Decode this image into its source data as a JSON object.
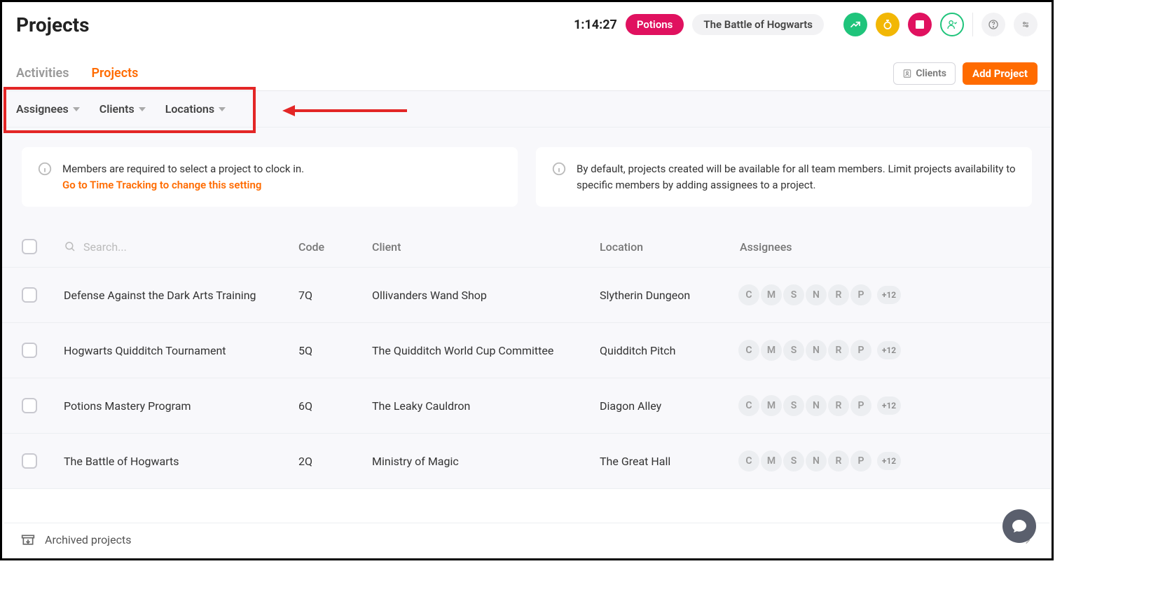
{
  "header": {
    "page_title": "Projects",
    "timer": "1:14:27",
    "pill_pink": "Potions",
    "pill_gray": "The Battle of Hogwarts"
  },
  "tabs": {
    "activities": "Activities",
    "projects": "Projects",
    "clients_btn": "Clients",
    "add_project_btn": "Add Project"
  },
  "filters": {
    "assignees": "Assignees",
    "clients": "Clients",
    "locations": "Locations"
  },
  "info": {
    "card1_line1": "Members are required to select a project to clock in.",
    "card1_link": "Go to Time Tracking to change this setting",
    "card2": "By default, projects created will be available for all team members. Limit projects availability to specific members by adding assignees to a project."
  },
  "table": {
    "search_placeholder": "Search...",
    "col_code": "Code",
    "col_client": "Client",
    "col_location": "Location",
    "col_assignees": "Assignees",
    "avatars": [
      "C",
      "M",
      "S",
      "N",
      "R",
      "P"
    ],
    "more": "+12",
    "rows": [
      {
        "name": "Defense Against the Dark Arts Training",
        "code": "7Q",
        "client": "Ollivanders Wand Shop",
        "location": "Slytherin Dungeon"
      },
      {
        "name": "Hogwarts Quidditch Tournament",
        "code": "5Q",
        "client": "The Quidditch World Cup Committee",
        "location": "Quidditch Pitch"
      },
      {
        "name": "Potions Mastery Program",
        "code": "6Q",
        "client": "The Leaky Cauldron",
        "location": "Diagon Alley"
      },
      {
        "name": "The Battle of Hogwarts",
        "code": "2Q",
        "client": "Ministry of Magic",
        "location": "The Great Hall"
      }
    ]
  },
  "footer": {
    "archived": "Archived projects"
  }
}
